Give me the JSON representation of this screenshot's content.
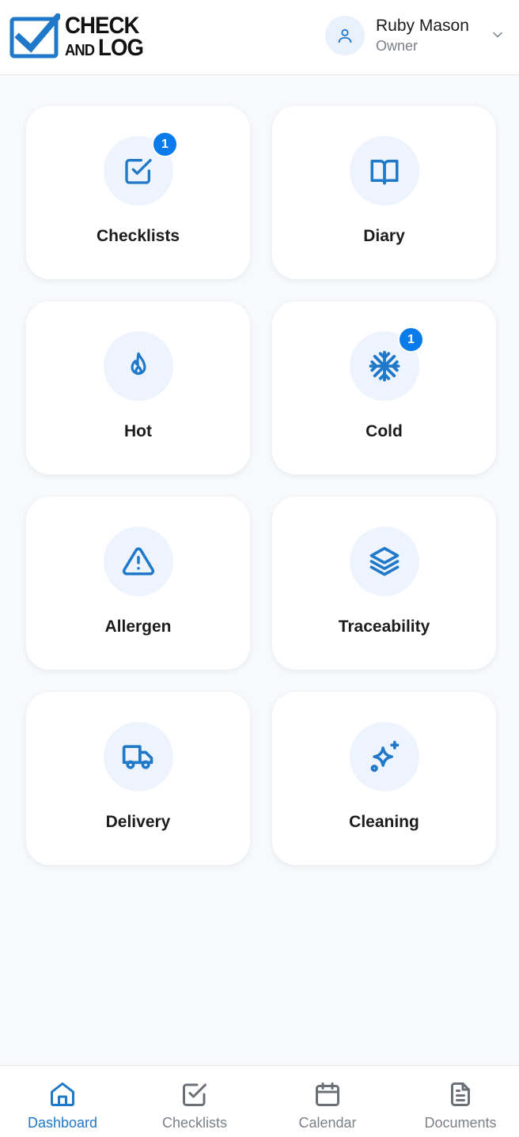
{
  "brand": {
    "logo_line1": "CHECK",
    "logo_and": "AND",
    "logo_log": "LOG",
    "accent": "#1f78c8"
  },
  "user": {
    "name": "Ruby Mason",
    "role": "Owner",
    "avatar_icon": "user-icon",
    "menu_icon": "chevron-down-icon"
  },
  "tiles": [
    {
      "label": "Checklists",
      "icon": "checkbox-icon",
      "badge": "1"
    },
    {
      "label": "Diary",
      "icon": "book-open-icon"
    },
    {
      "label": "Hot",
      "icon": "flame-icon"
    },
    {
      "label": "Cold",
      "icon": "snowflake-icon",
      "badge": "1"
    },
    {
      "label": "Allergen",
      "icon": "warning-triangle-icon"
    },
    {
      "label": "Traceability",
      "icon": "layers-icon"
    },
    {
      "label": "Delivery",
      "icon": "truck-icon"
    },
    {
      "label": "Cleaning",
      "icon": "sparkles-icon"
    }
  ],
  "nav": [
    {
      "label": "Dashboard",
      "icon": "home-icon",
      "active": true
    },
    {
      "label": "Checklists",
      "icon": "checkbox-icon"
    },
    {
      "label": "Calendar",
      "icon": "calendar-icon"
    },
    {
      "label": "Documents",
      "icon": "document-icon"
    }
  ],
  "colors": {
    "badge": "#0a7bea",
    "icon": "#1f78c8",
    "icon_bg": "#edf4fd"
  }
}
